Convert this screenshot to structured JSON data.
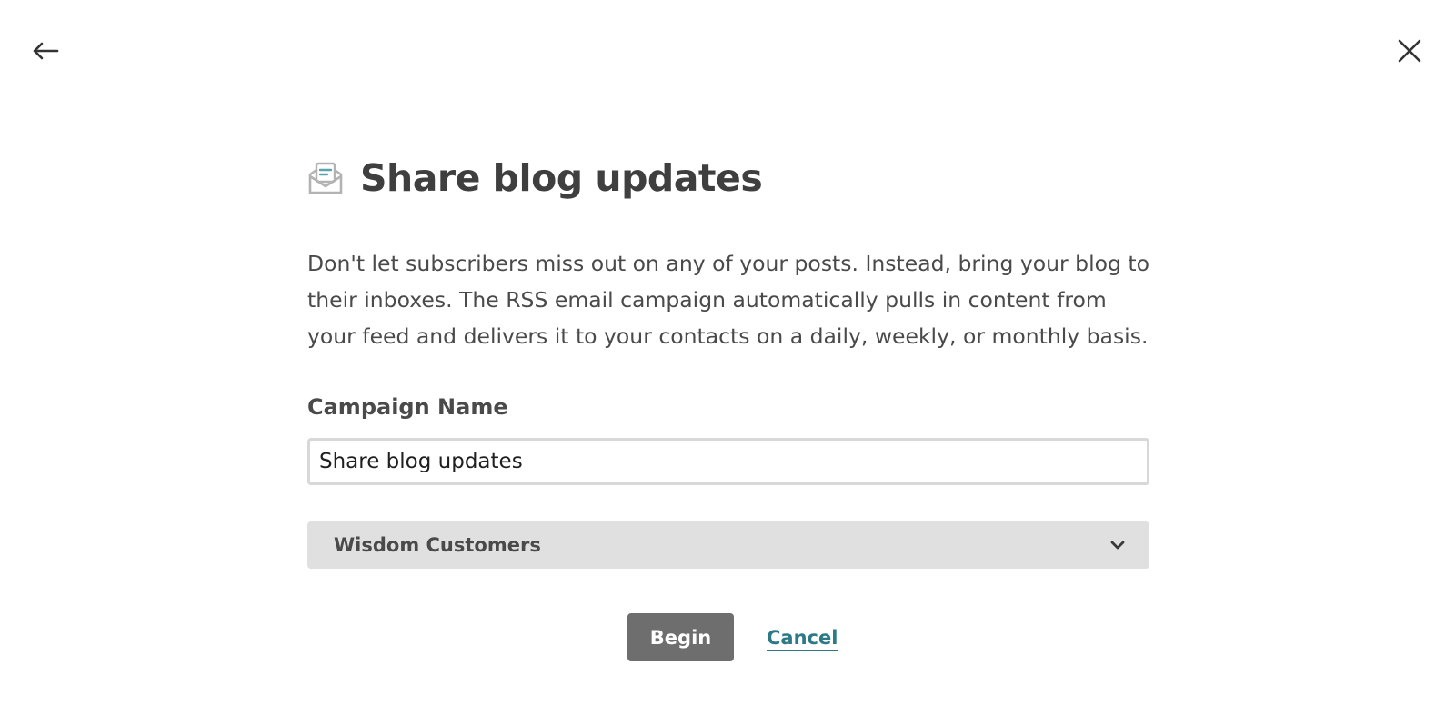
{
  "topbar": {
    "back_icon": "arrow-left-icon",
    "close_icon": "close-icon"
  },
  "main": {
    "title_icon": "envelope-newsletter-icon",
    "title": "Share blog updates",
    "description": "Don't let subscribers miss out on any of your posts. Instead, bring your blog to their inboxes. The RSS email campaign automatically pulls in content from your feed and delivers it to your contacts on a daily, weekly, or monthly basis.",
    "campaign_name_label": "Campaign Name",
    "campaign_name_value": "Share blog updates",
    "audience_selected": "Wisdom Customers",
    "begin_label": "Begin",
    "cancel_label": "Cancel"
  },
  "colors": {
    "accent_link": "#2b7a86",
    "primary_button": "#6e6e6e",
    "select_background": "#e0e0e0"
  }
}
